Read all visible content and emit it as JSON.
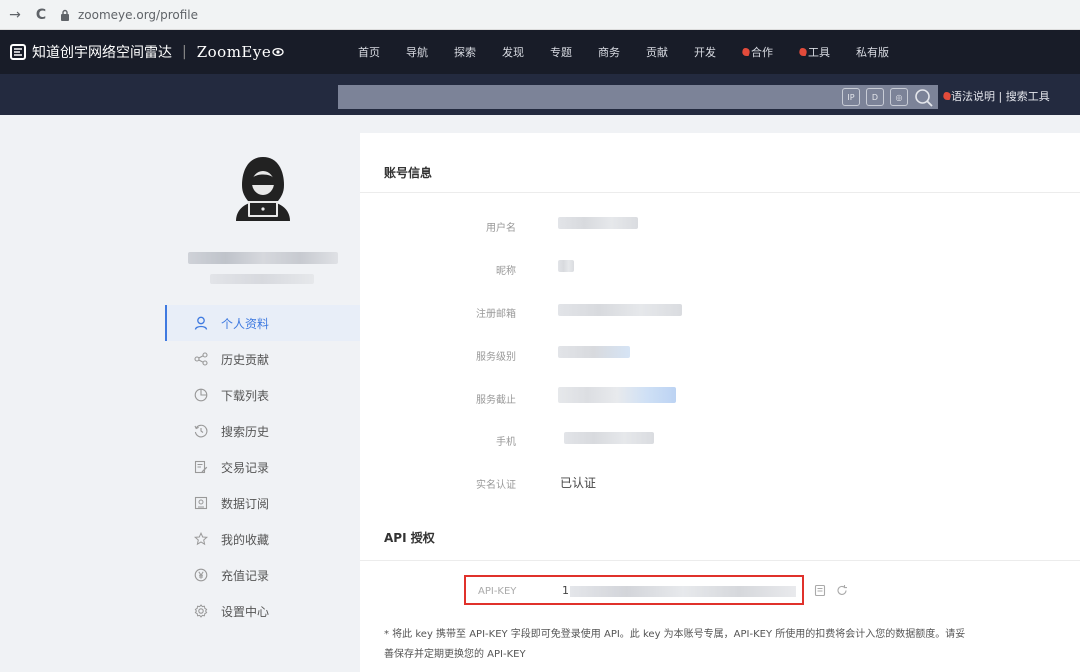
{
  "browser": {
    "back": "→",
    "reload": "C",
    "url": "zoomeye.org/profile"
  },
  "header": {
    "logo_cn": "知道创宇网络空间雷达",
    "logo_sep": "|",
    "logo_en": "ZoomEye",
    "nav": [
      {
        "label": "首页"
      },
      {
        "label": "导航"
      },
      {
        "label": "探索"
      },
      {
        "label": "发现"
      },
      {
        "label": "专题"
      },
      {
        "label": "商务"
      },
      {
        "label": "贡献"
      },
      {
        "label": "开发"
      },
      {
        "label": "合作"
      },
      {
        "label": "工具"
      },
      {
        "label": "私有版"
      }
    ]
  },
  "search": {
    "links": "语法说明 | 搜索工具"
  },
  "sidebar": {
    "items": [
      {
        "label": "个人资料",
        "icon": "user-icon"
      },
      {
        "label": "历史贡献",
        "icon": "share-icon"
      },
      {
        "label": "下载列表",
        "icon": "pie-chart-icon"
      },
      {
        "label": "搜索历史",
        "icon": "history-icon"
      },
      {
        "label": "交易记录",
        "icon": "edit-document-icon"
      },
      {
        "label": "数据订阅",
        "icon": "subscribe-icon"
      },
      {
        "label": "我的收藏",
        "icon": "star-icon"
      },
      {
        "label": "充值记录",
        "icon": "yen-icon"
      },
      {
        "label": "设置中心",
        "icon": "settings-icon"
      }
    ]
  },
  "account": {
    "title": "账号信息",
    "fields": [
      {
        "label": "用户名"
      },
      {
        "label": "昵称"
      },
      {
        "label": "注册邮箱"
      },
      {
        "label": "服务级别"
      },
      {
        "label": "服务截止"
      },
      {
        "label": "手机"
      },
      {
        "label": "实名认证",
        "value": "已认证"
      }
    ]
  },
  "api": {
    "title": "API 授权",
    "key_label": "API-KEY",
    "key_value_start": "1",
    "note_line1": "* 将此 key 携带至 API-KEY 字段即可免登录使用 API。此 key 为本账号专属，API-KEY 所使用的扣费将会计入您的数据额度。请妥",
    "note_line2": "善保存并定期更换您的 API-KEY"
  },
  "colors": {
    "header_bg": "#181c28",
    "search_band_bg": "#232a3f",
    "accent": "#3f7ae0",
    "highlight_box": "#e0312b"
  }
}
